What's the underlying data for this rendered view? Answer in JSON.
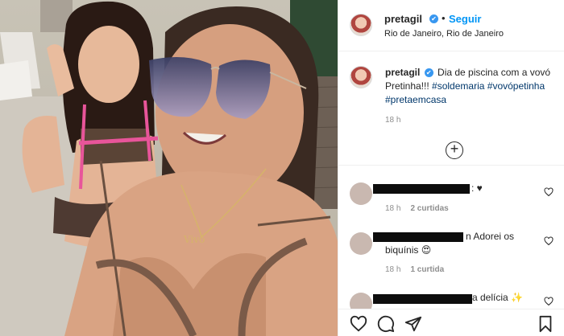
{
  "header": {
    "username": "pretagil",
    "verified_mark": "✔",
    "separator": "•",
    "follow_label": "Seguir",
    "location": "Rio de Janeiro, Rio de Janeiro"
  },
  "caption": {
    "username": "pretagil",
    "text": "Dia de piscina com a vovó Pretinha!!!",
    "hashtags": [
      "#soldemaria",
      "#vovópetinha",
      "#pretaemcasa"
    ],
    "time": "18 h"
  },
  "comments": [
    {
      "text": ": ♥",
      "time": "18 h",
      "likes": "2 curtidas"
    },
    {
      "text": "n Adorei os biquínis 😍",
      "time": "18 h",
      "likes": "1 curtida"
    },
    {
      "text": "a delícia ✨",
      "time": "",
      "likes": ""
    }
  ],
  "icons": {
    "more": "plus-circle-icon",
    "like": "heart-icon",
    "comment": "comment-icon",
    "share": "paper-plane-icon",
    "save": "bookmark-icon"
  },
  "colors": {
    "accent": "#0095f6",
    "verified": "#3897f0",
    "muted": "#8e8e8e"
  }
}
